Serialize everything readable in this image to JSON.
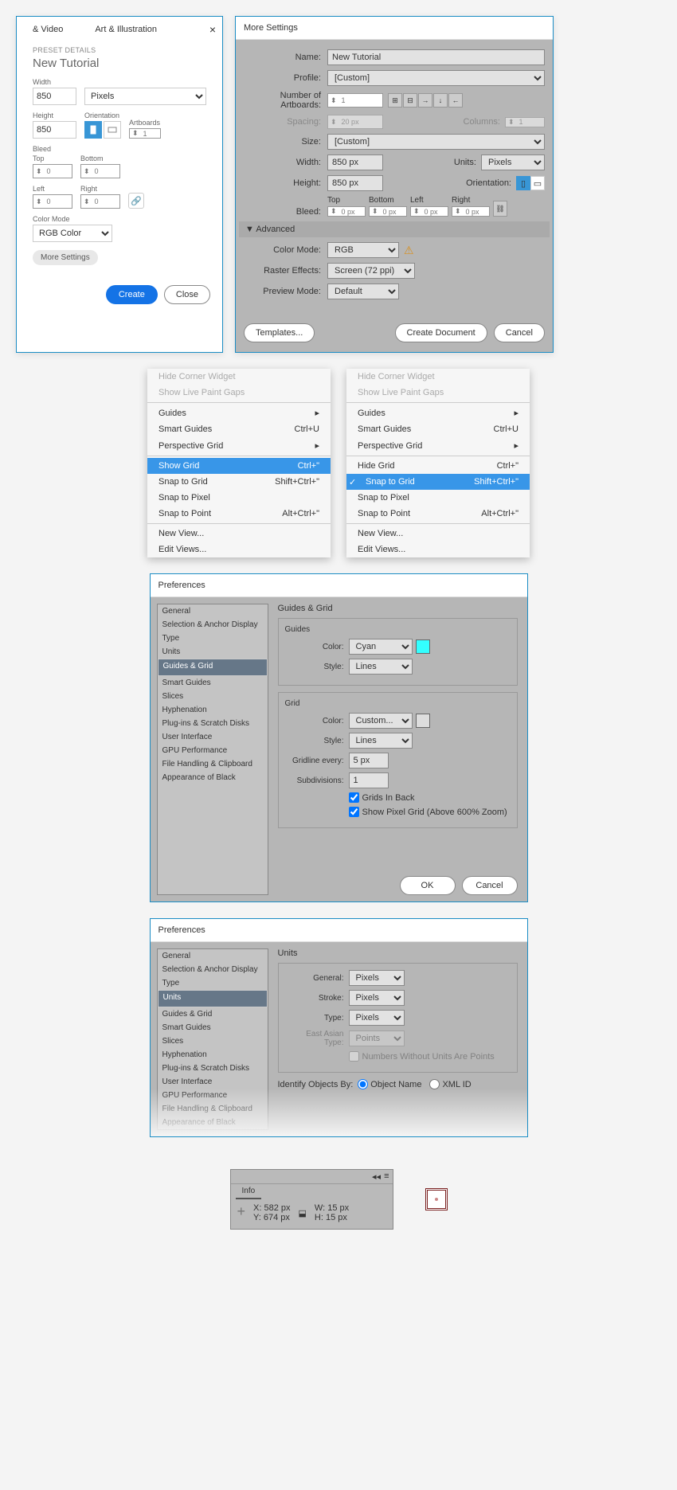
{
  "newdoc": {
    "tab1": "& Video",
    "tab2": "Art & Illustration",
    "preset_lbl": "PRESET DETAILS",
    "title": "New Tutorial",
    "width_lbl": "Width",
    "width": "850",
    "units": "Pixels",
    "height_lbl": "Height",
    "height": "850",
    "orient_lbl": "Orientation",
    "artboards_lbl": "Artboards",
    "artboards": "1",
    "bleed_lbl": "Bleed",
    "top_lbl": "Top",
    "bottom_lbl": "Bottom",
    "left_lbl": "Left",
    "right_lbl": "Right",
    "top": "0",
    "bottom": "0",
    "left": "0",
    "right": "0",
    "cmode_lbl": "Color Mode",
    "cmode": "RGB Color",
    "more": "More Settings",
    "create": "Create",
    "close": "Close"
  },
  "ms": {
    "title": "More Settings",
    "name_lbl": "Name:",
    "name": "New Tutorial",
    "profile_lbl": "Profile:",
    "profile": "[Custom]",
    "nab_lbl": "Number of Artboards:",
    "nab": "1",
    "spacing_lbl": "Spacing:",
    "spacing": "20 px",
    "cols_lbl": "Columns:",
    "cols": "1",
    "size_lbl": "Size:",
    "size": "[Custom]",
    "width_lbl": "Width:",
    "width": "850 px",
    "units_lbl": "Units:",
    "units": "Pixels",
    "height_lbl": "Height:",
    "height": "850 px",
    "orient_lbl": "Orientation:",
    "bleed_lbl": "Bleed:",
    "top_lbl": "Top",
    "bottom_lbl": "Bottom",
    "left_lbl": "Left",
    "right_lbl": "Right",
    "btop": "0 px",
    "bbottom": "0 px",
    "bleft": "0 px",
    "bright": "0 px",
    "adv": "Advanced",
    "cmode_lbl": "Color Mode:",
    "cmode": "RGB",
    "raster_lbl": "Raster Effects:",
    "raster": "Screen (72 ppi)",
    "preview_lbl": "Preview Mode:",
    "preview": "Default",
    "templates": "Templates...",
    "createdoc": "Create Document",
    "cancel": "Cancel"
  },
  "menu1": {
    "hcw": "Hide Corner Widget",
    "slpg": "Show Live Paint Gaps",
    "guides": "Guides",
    "sg": "Smart Guides",
    "sg_k": "Ctrl+U",
    "pg": "Perspective Grid",
    "showg": "Show Grid",
    "showg_k": "Ctrl+\"",
    "sng": "Snap to Grid",
    "sng_k": "Shift+Ctrl+\"",
    "snp": "Snap to Pixel",
    "snpt": "Snap to Point",
    "snpt_k": "Alt+Ctrl+\"",
    "nv": "New View...",
    "ev": "Edit Views..."
  },
  "menu2": {
    "hcw": "Hide Corner Widget",
    "slpg": "Show Live Paint Gaps",
    "guides": "Guides",
    "sg": "Smart Guides",
    "sg_k": "Ctrl+U",
    "pg": "Perspective Grid",
    "hideg": "Hide Grid",
    "hideg_k": "Ctrl+\"",
    "sng": "Snap to Grid",
    "sng_k": "Shift+Ctrl+\"",
    "snp": "Snap to Pixel",
    "snpt": "Snap to Point",
    "snpt_k": "Alt+Ctrl+\"",
    "nv": "New View...",
    "ev": "Edit Views..."
  },
  "prefs": {
    "title": "Preferences",
    "cats": [
      "General",
      "Selection & Anchor Display",
      "Type",
      "Units",
      "Guides & Grid",
      "Smart Guides",
      "Slices",
      "Hyphenation",
      "Plug-ins & Scratch Disks",
      "User Interface",
      "GPU Performance",
      "File Handling & Clipboard",
      "Appearance of Black"
    ],
    "gg": {
      "pane": "Guides & Grid",
      "guides_t": "Guides",
      "grid_t": "Grid",
      "color_lbl": "Color:",
      "gcolor": "Cyan",
      "style_lbl": "Style:",
      "gstyle": "Lines",
      "grcolor": "Custom...",
      "grstyle": "Lines",
      "gle_lbl": "Gridline every:",
      "gle": "5 px",
      "sub_lbl": "Subdivisions:",
      "sub": "1",
      "gib": "Grids In Back",
      "spg": "Show Pixel Grid (Above 600% Zoom)"
    },
    "units": {
      "pane": "Units",
      "gen_lbl": "General:",
      "gen": "Pixels",
      "stroke_lbl": "Stroke:",
      "stroke": "Pixels",
      "type_lbl": "Type:",
      "type": "Pixels",
      "eat_lbl": "East Asian Type:",
      "eat": "Points",
      "nwu": "Numbers Without Units Are Points",
      "iob_lbl": "Identify Objects By:",
      "obj": "Object Name",
      "xml": "XML ID"
    },
    "ok": "OK",
    "cancel": "Cancel"
  },
  "info": {
    "tab": "Info",
    "x_lbl": "X:",
    "x": "582 px",
    "y_lbl": "Y:",
    "y": "674 px",
    "w_lbl": "W:",
    "w": "15 px",
    "h_lbl": "H:",
    "h": "15 px"
  }
}
